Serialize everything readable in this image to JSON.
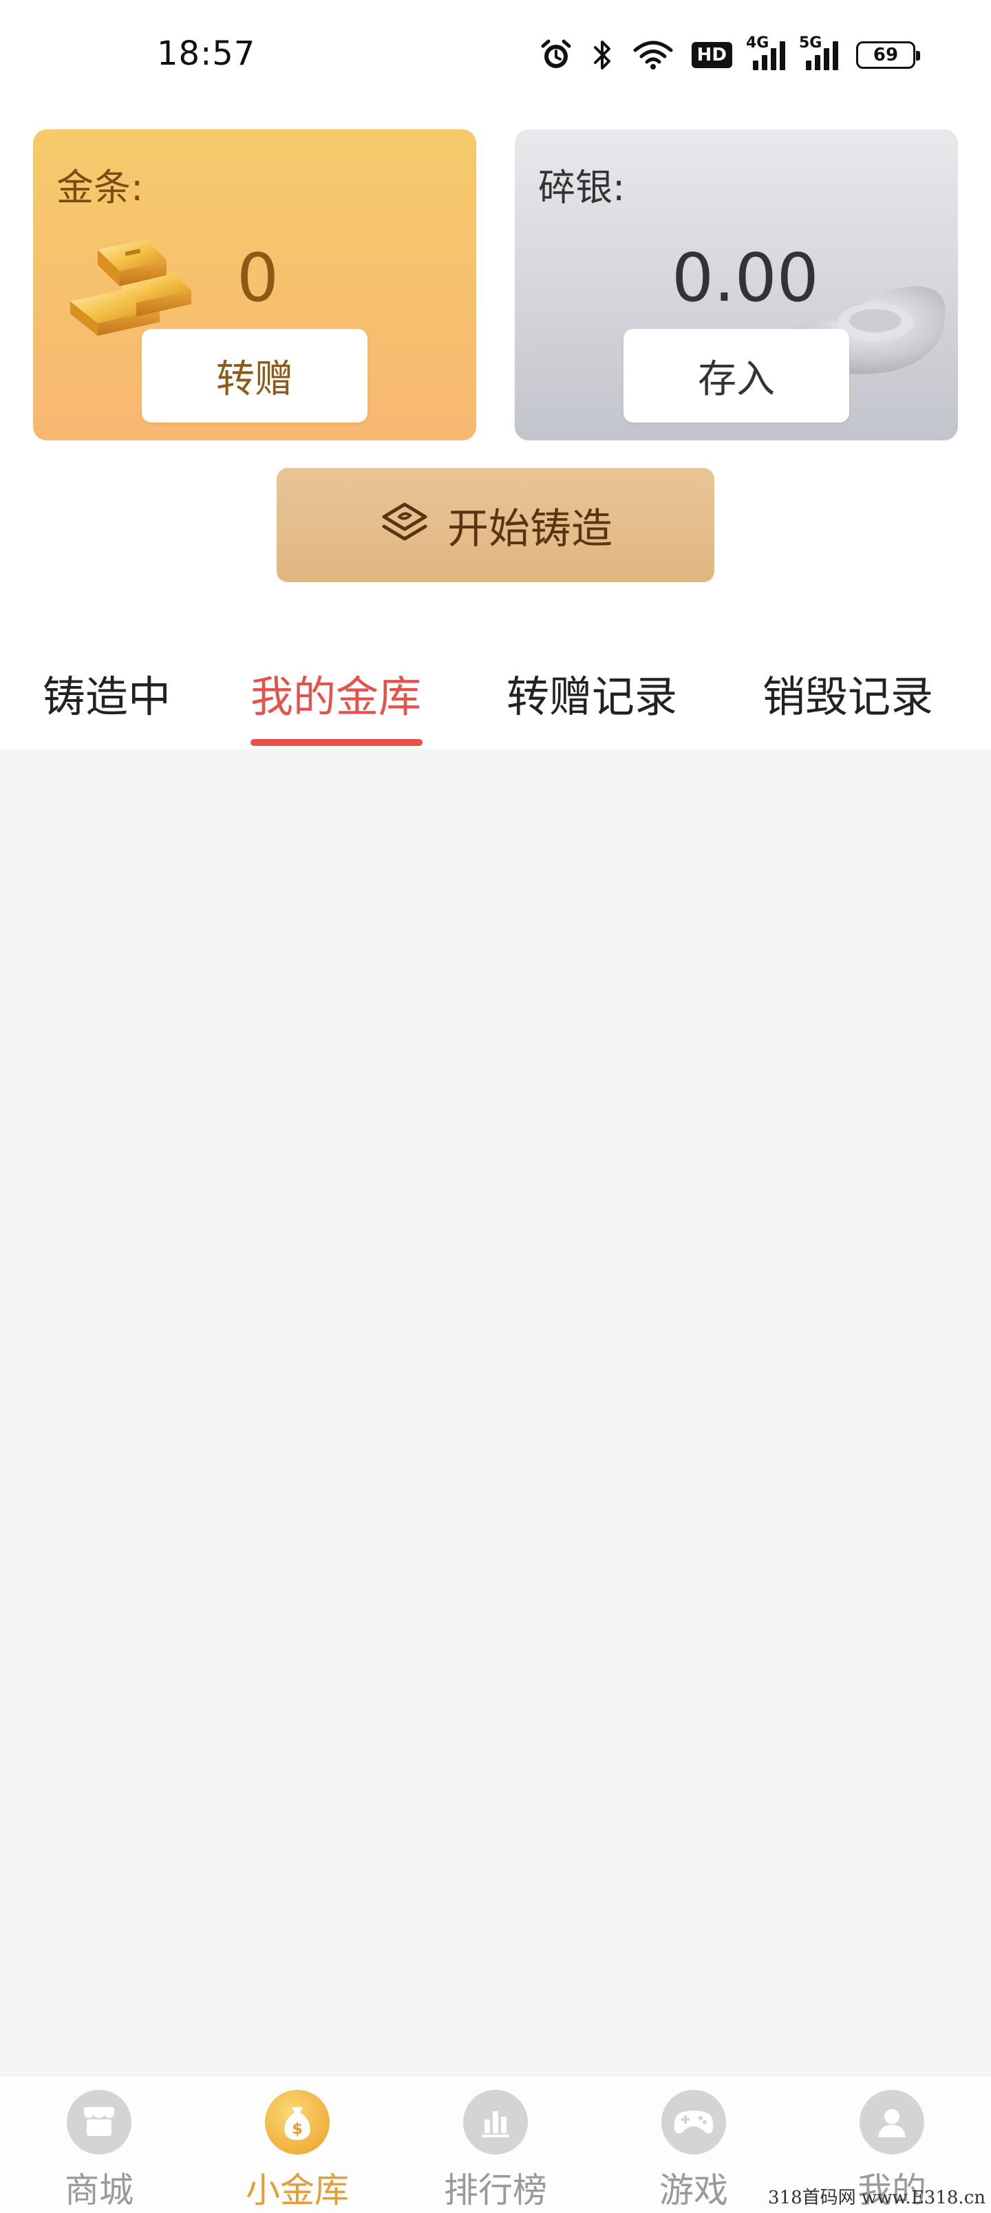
{
  "status_bar": {
    "time": "18:57",
    "icons": [
      "alarm-icon",
      "bluetooth-icon",
      "wifi-icon",
      "hd-icon",
      "signal-4g-icon",
      "signal-5g-icon",
      "battery-icon"
    ],
    "hd_label": "HD",
    "network_1": "4G",
    "network_2": "5G",
    "battery": "69"
  },
  "gold_card": {
    "label": "金条:",
    "value": "0",
    "button": "转赠",
    "icon": "gold-bars-icon"
  },
  "silver_card": {
    "label": "碎银:",
    "value": "0.00",
    "button": "存入",
    "icon": "silver-ingot-icon"
  },
  "cast_button": {
    "label": "开始铸造",
    "icon": "layers-icon"
  },
  "tabs": [
    {
      "label": "铸造中",
      "active": false
    },
    {
      "label": "我的金库",
      "active": true
    },
    {
      "label": "转赠记录",
      "active": false
    },
    {
      "label": "销毁记录",
      "active": false
    }
  ],
  "bottom_nav": [
    {
      "label": "商城",
      "icon": "shop-icon",
      "active": false
    },
    {
      "label": "小金库",
      "icon": "money-bag-icon",
      "active": true
    },
    {
      "label": "排行榜",
      "icon": "bar-chart-icon",
      "active": false
    },
    {
      "label": "游戏",
      "icon": "gamepad-icon",
      "active": false
    },
    {
      "label": "我的",
      "icon": "user-icon",
      "active": false
    }
  ],
  "watermark": "318首码网 www.E318.cn",
  "colors": {
    "accent_red": "#e5524c",
    "gold_text": "#8a5a16",
    "nav_active": "#e0a037",
    "content_bg": "#f5f5f5"
  }
}
